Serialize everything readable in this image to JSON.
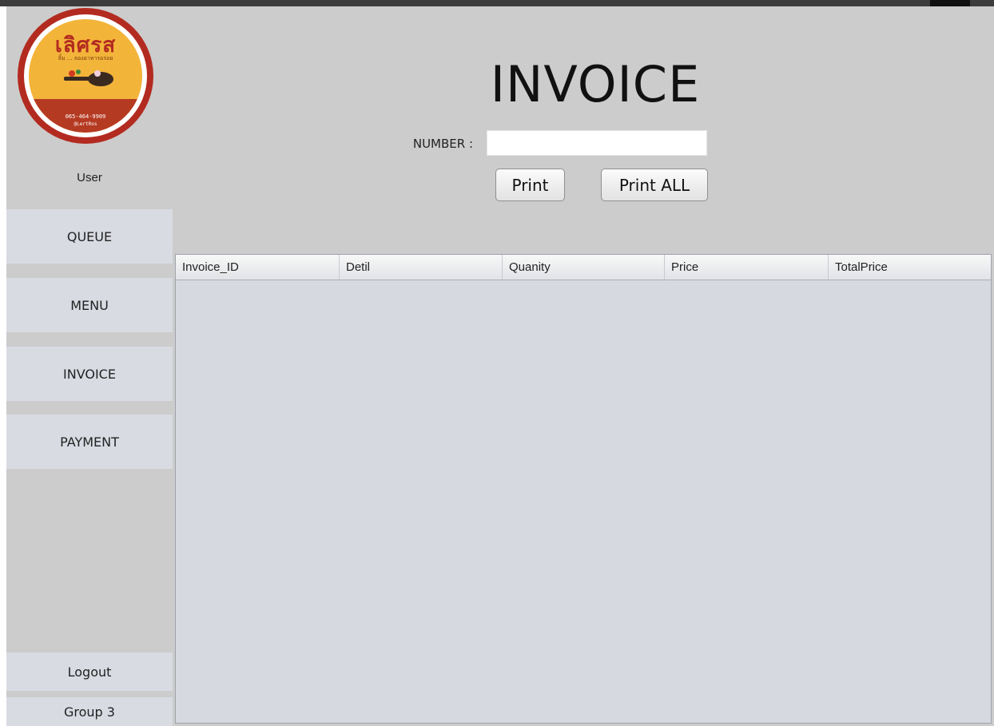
{
  "logo": {
    "brand": "เลิศรส",
    "tagline": "ลิ้ม ... ลองอาหารอร่อย",
    "phone": "065-464-9909",
    "social": "@LertRos"
  },
  "sidebar": {
    "user_label": "User",
    "items": [
      {
        "label": "QUEUE"
      },
      {
        "label": "MENU"
      },
      {
        "label": "INVOICE"
      },
      {
        "label": "PAYMENT"
      }
    ],
    "logout_label": "Logout",
    "group_label": "Group 3"
  },
  "header": {
    "title": "INVOICE",
    "number_label": "NUMBER :",
    "number_value": "",
    "print_label": "Print",
    "print_all_label": "Print ALL"
  },
  "table": {
    "columns": [
      "Invoice_ID",
      "Detil",
      "Quanity",
      "Price",
      "TotalPrice"
    ],
    "rows": []
  },
  "colors": {
    "window_bg": "#cccccc",
    "nav_bg": "#d8dbe2",
    "table_bg": "#d6d9e0",
    "logo_red": "#b32b20",
    "logo_yellow": "#f3b43a"
  }
}
